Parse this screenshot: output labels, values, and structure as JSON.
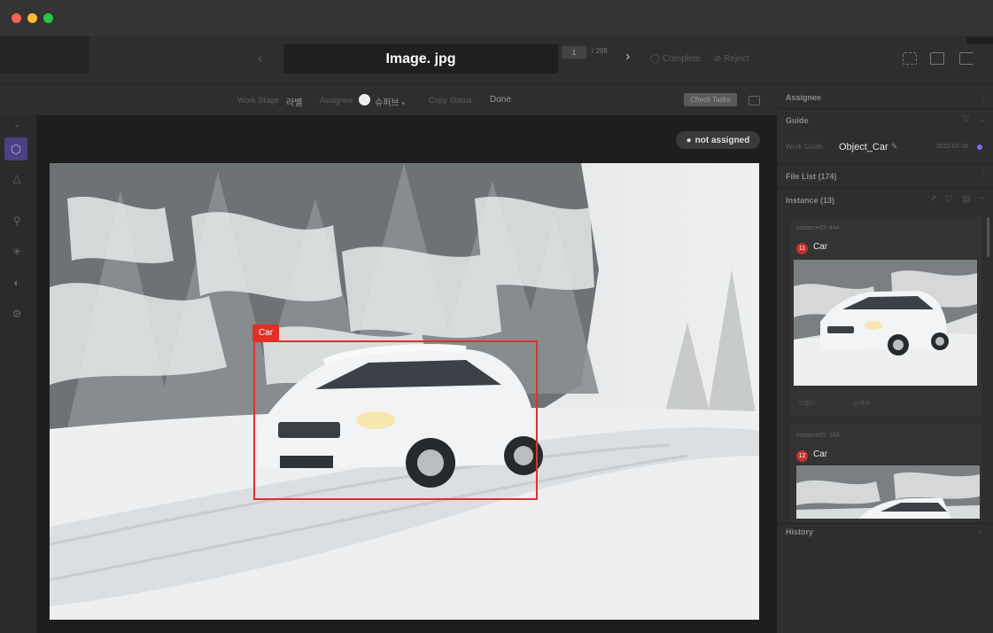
{
  "window": {
    "controls": [
      "close",
      "minimize",
      "maximize"
    ]
  },
  "toolbar": {
    "file_name": "Image. jpg",
    "page_current": "1",
    "page_total": "/ 298",
    "complete_label": "Complete",
    "reject_label": "Reject"
  },
  "subbar": {
    "work_stage_label": "Work Stage",
    "work_stage_value": "라벨",
    "assignee_label": "Assignee",
    "assignee_value": "슈퍼브",
    "copy_to_label": "Copy Status",
    "status_value": "Done",
    "check_tasks_label": "Check Tasks"
  },
  "canvas": {
    "assignment_badge": "not assigned",
    "annotation": {
      "label": "Car",
      "color": "#e0302a"
    }
  },
  "right_panel": {
    "assignee_title": "Assignee",
    "guide_title": "Guide",
    "work_guide_label": "Work Guide",
    "work_guide_value": "Object_Car",
    "guide_date": "2022-07-18",
    "file_list_title": "File List (174)",
    "instance_title": "Instance (13)",
    "history_title": "History",
    "instances": [
      {
        "id": "instanceID: 444",
        "badge": "11",
        "class": "Car",
        "meta_left": "라벨러",
        "meta_right": "슈퍼브"
      },
      {
        "id": "instanceID: 334",
        "badge": "12",
        "class": "Car"
      }
    ]
  },
  "colors": {
    "accent": "#7b6cff",
    "annotation_red": "#e0302a",
    "background": "#2b2b2b"
  }
}
